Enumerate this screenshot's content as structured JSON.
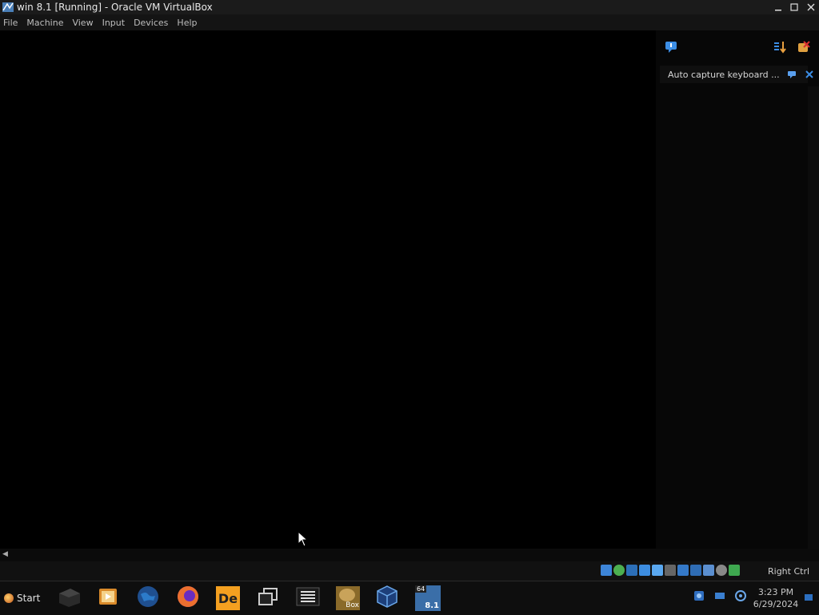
{
  "window": {
    "title": "win 8.1 [Running] - Oracle VM VirtualBox"
  },
  "menu": {
    "items": [
      {
        "label": "File"
      },
      {
        "label": "Machine"
      },
      {
        "label": "View"
      },
      {
        "label": "Input"
      },
      {
        "label": "Devices"
      },
      {
        "label": "Help"
      }
    ]
  },
  "notification": {
    "text": "Auto capture keyboard ..."
  },
  "statusbar": {
    "host_key": "Right Ctrl"
  },
  "taskbar": {
    "start_label": "Start",
    "apps": [
      {
        "icon": "terminal-box-icon"
      },
      {
        "icon": "media-player-icon"
      },
      {
        "icon": "globe-browser-icon"
      },
      {
        "icon": "firefox-icon"
      },
      {
        "icon": "de-app-icon",
        "text": "De"
      },
      {
        "icon": "windows-stack-icon"
      },
      {
        "icon": "text-lines-icon"
      },
      {
        "icon": "box-app-icon",
        "text": "Box"
      },
      {
        "icon": "virtualbox-cube-icon"
      },
      {
        "icon": "win81-vm-icon",
        "text": "8.1",
        "badge": "64"
      }
    ]
  },
  "clock": {
    "time": "3:23 PM",
    "date": "6/29/2024"
  }
}
